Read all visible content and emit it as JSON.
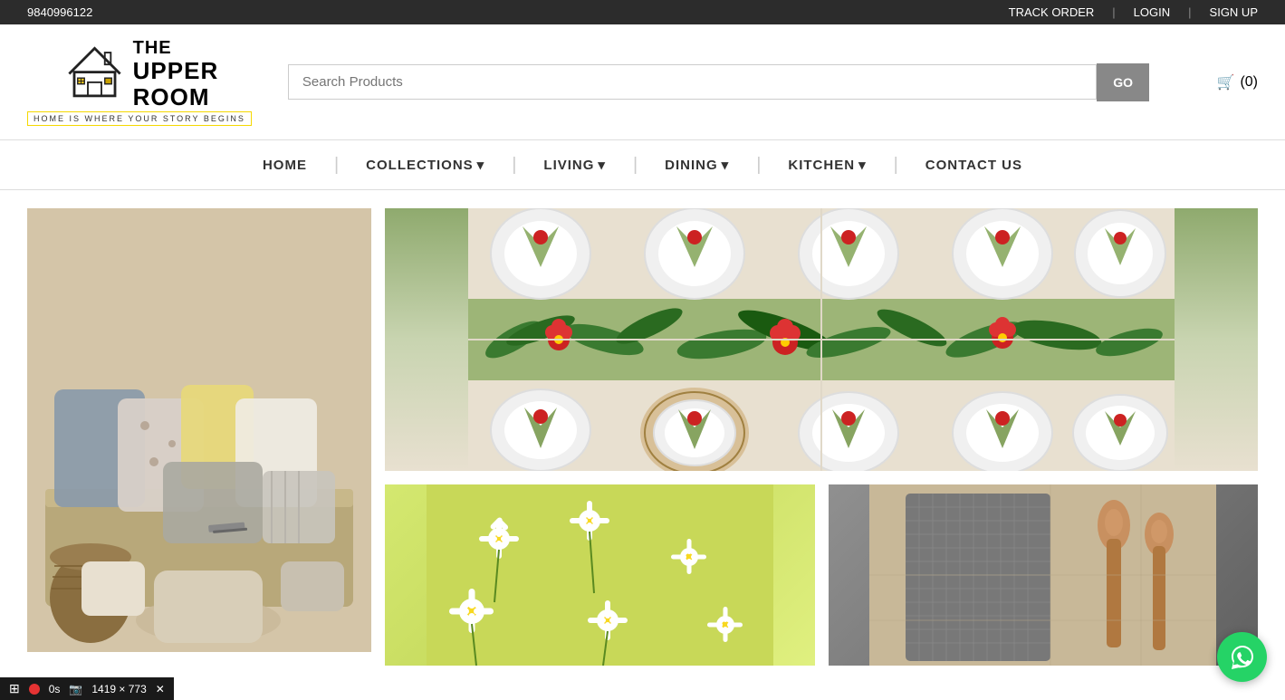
{
  "topBar": {
    "phone": "9840996122",
    "trackOrder": "TRACK ORDER",
    "login": "LOGIN",
    "signUp": "SIGN UP"
  },
  "header": {
    "logoLine1": "THE",
    "logoLine2": "UPPER",
    "logoLine3": "ROOM",
    "tagline": "HOME IS WHERE YOUR STORY BEGINS",
    "searchPlaceholder": "Search Products",
    "searchBtn": "GO",
    "cartLabel": "(0)"
  },
  "nav": {
    "items": [
      {
        "label": "HOME",
        "hasDropdown": false
      },
      {
        "label": "COLLECTIONS",
        "hasDropdown": true
      },
      {
        "label": "LIVING",
        "hasDropdown": true
      },
      {
        "label": "DINING",
        "hasDropdown": true
      },
      {
        "label": "KITCHEN",
        "hasDropdown": true
      },
      {
        "label": "CONTACT US",
        "hasDropdown": false
      }
    ]
  },
  "images": {
    "pillows": "Living room pillows and cushions",
    "tableSettings": "Tropical table settings with green leaves and red flowers",
    "daisyTowel": "Daisy pattern kitchen textile",
    "grayTowel": "Gray waffle towel with wooden spoon"
  },
  "whatsapp": {
    "label": "WhatsApp Chat"
  },
  "toolbar": {
    "dimensions": "1419 × 773",
    "timer": "0s"
  }
}
